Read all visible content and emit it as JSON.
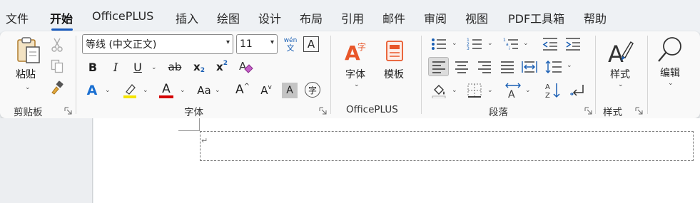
{
  "menu": {
    "tabs": [
      "文件",
      "开始",
      "OfficePLUS",
      "插入",
      "绘图",
      "设计",
      "布局",
      "引用",
      "邮件",
      "审阅",
      "视图",
      "PDF工具箱",
      "帮助"
    ],
    "active": "开始"
  },
  "clipboard": {
    "paste_label": "粘贴",
    "group_label": "剪贴板"
  },
  "font": {
    "font_name": "等线 (中文正文)",
    "font_size": "11",
    "phonetic_top": "wén",
    "phonetic_bottom": "文",
    "text_a_label": "A",
    "bold": "B",
    "italic": "I",
    "underline": "U",
    "strikethrough": "ab",
    "subscript_main": "x",
    "subscript_sub": "2",
    "superscript_main": "x",
    "superscript_sup": "2",
    "text_effects": "A",
    "highlight_text": "ab",
    "font_color": "A",
    "change_case": "Aa",
    "grow": "A",
    "shrink": "A",
    "char_shading": "A",
    "enclose_char": "字",
    "group_label": "字体",
    "highlight_color": "#f5e400",
    "font_color_bar": "#d40000"
  },
  "officeplus": {
    "font_label": "字体",
    "template_label": "模板",
    "group_label": "OfficePLUS",
    "accent": "#e8572a"
  },
  "paragraph": {
    "group_label": "段落"
  },
  "styles": {
    "label": "样式",
    "group_label": "样式"
  },
  "editing": {
    "label": "编辑"
  },
  "document": {
    "paragraph_mark": "↵"
  }
}
